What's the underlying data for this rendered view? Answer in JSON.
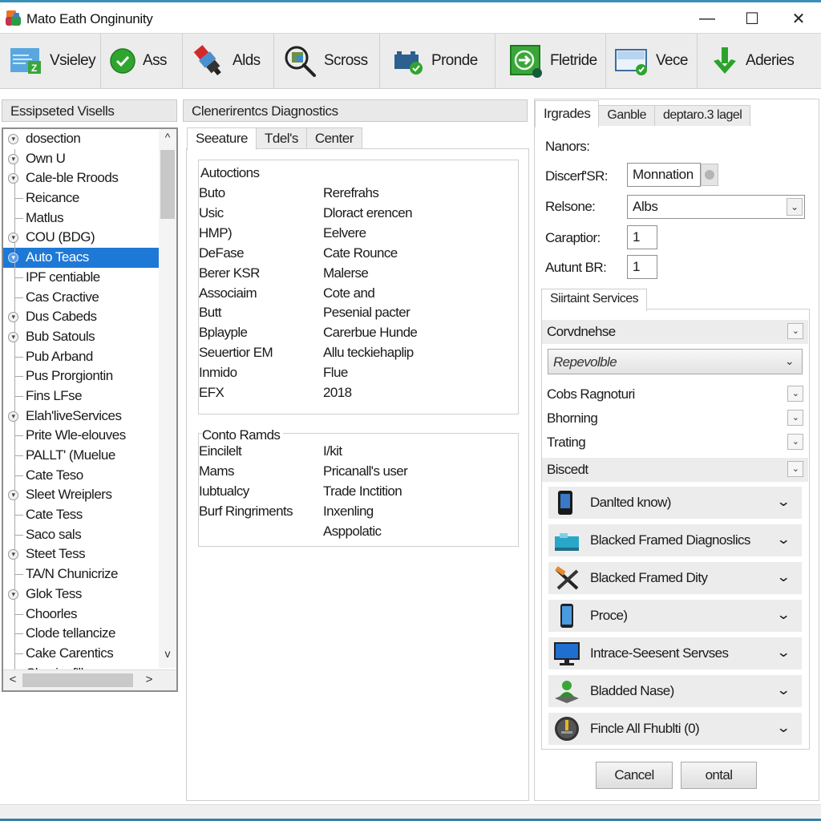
{
  "window": {
    "title": "Mato Eath Onginunity",
    "controls": {
      "minimize": "—",
      "maximize": "☐",
      "close": "✕"
    }
  },
  "toolbar": {
    "buttons": [
      {
        "label": "Vsieley",
        "icon": "spreadsheet-icon"
      },
      {
        "label": "Ass",
        "icon": "green-check-circle-icon"
      },
      {
        "label": "Alds",
        "icon": "connector-plug-icon"
      },
      {
        "label": "Scross",
        "icon": "magnifier-icon"
      },
      {
        "label": "Pronde",
        "icon": "battery-check-icon"
      },
      {
        "label": "Fletride",
        "icon": "green-arrow-box-icon"
      },
      {
        "label": "Vece",
        "icon": "monitor-check-icon"
      },
      {
        "label": "Aderies",
        "icon": "green-down-arrow-icon"
      }
    ]
  },
  "left_panel": {
    "header": "Essipseted Visells",
    "tree": [
      {
        "label": "dosection",
        "expandable": true,
        "root": true
      },
      {
        "label": "Own U",
        "expandable": true
      },
      {
        "label": "Cale-ble Rroods",
        "expandable": true
      },
      {
        "label": "Reicance",
        "expandable": false
      },
      {
        "label": "Matlus",
        "expandable": false
      },
      {
        "label": "COU (BDG)",
        "expandable": true
      },
      {
        "label": "Auto Teacs",
        "expandable": true,
        "selected": true
      },
      {
        "label": "IPF centiable",
        "expandable": false
      },
      {
        "label": "Cas Cractive",
        "expandable": false
      },
      {
        "label": "Dus Cabeds",
        "expandable": true
      },
      {
        "label": "Bub Satouls",
        "expandable": true
      },
      {
        "label": "Pub Arband",
        "expandable": false
      },
      {
        "label": "Pus Prorgiontin",
        "expandable": false
      },
      {
        "label": "Fins LFse",
        "expandable": false
      },
      {
        "label": "Elah'liveServices",
        "expandable": true
      },
      {
        "label": "Prite Wle-elouves",
        "expandable": false
      },
      {
        "label": "PALLT' (Muelue",
        "expandable": false
      },
      {
        "label": "Cate Teso",
        "expandable": false
      },
      {
        "label": "Sleet Wreiplers",
        "expandable": true
      },
      {
        "label": "Cate Tess",
        "expandable": false
      },
      {
        "label": "Saco sals",
        "expandable": false
      },
      {
        "label": "Steet Tess",
        "expandable": true
      },
      {
        "label": "TA/N Chunicrize",
        "expandable": false
      },
      {
        "label": "Glok Tess",
        "expandable": true
      },
      {
        "label": "Choorles",
        "expandable": false
      },
      {
        "label": "Clode tellancize",
        "expandable": false
      },
      {
        "label": "Cake Carentics",
        "expandable": false
      },
      {
        "label": "Clasrionf'll",
        "expandable": false
      }
    ],
    "scroll": {
      "up": "^",
      "down": "v",
      "left": "<",
      "right": ">"
    }
  },
  "middle_panel": {
    "header": "Clenerirentcs Diagnostics",
    "tabs": [
      "Seeature",
      "Tdel's",
      "Center"
    ],
    "active_tab": 0,
    "group1": {
      "title": "Autoctions",
      "rows": [
        {
          "key": "Buto",
          "value": "Rerefrahs"
        },
        {
          "key": "Usic",
          "value": "Dloract erencen"
        },
        {
          "key": "HMP)",
          "value": "Eelvere"
        },
        {
          "key": "DeFase",
          "value": "Cate Rounce"
        },
        {
          "key": "Berer KSR",
          "value": "Malerse"
        },
        {
          "key": "Associaim",
          "value": "Cote and"
        },
        {
          "key": "Butt",
          "value": "Pesenial pacter"
        },
        {
          "key": "Bplayple",
          "value": "Carerbue Hunde"
        },
        {
          "key": "Seuertior EM",
          "value": "Allu teckiehaplip"
        },
        {
          "key": "Inmido",
          "value": "Flue"
        },
        {
          "key": "EFX",
          "value": "2018"
        }
      ]
    },
    "group2": {
      "title": "Conto Ramds",
      "rows": [
        {
          "key": "Eincilelt",
          "value": "I/kit"
        },
        {
          "key": "Mams",
          "value": "Pricanall's user"
        },
        {
          "key": "Iubtualcy",
          "value": "Trade Inctition"
        },
        {
          "key": "Burf Ringriments",
          "value": "Inxenling"
        },
        {
          "key": "",
          "value": "Asppolatic"
        }
      ]
    }
  },
  "right_panel": {
    "tabs": [
      "Irgrades",
      "Ganble",
      "deptaro.3 lagel"
    ],
    "active_tab": 0,
    "form": {
      "section_label": "Nanors:",
      "fields": [
        {
          "label": "Discerf'SR:",
          "value": "Monnation"
        },
        {
          "label": "Relsone:",
          "value": "Albs"
        },
        {
          "label": "Caraptior:",
          "value": "1"
        },
        {
          "label": "Autunt BR:",
          "value": "1"
        }
      ]
    },
    "services": {
      "tab": "Siirtaint Services",
      "rows": [
        {
          "label": "Corvdnehse",
          "shaded": true
        },
        {
          "label": "Cobs Ragnoturi",
          "shaded": false
        },
        {
          "label": "Bhorning",
          "shaded": false
        },
        {
          "label": "Trating",
          "shaded": false
        },
        {
          "label": "Biscedt",
          "shaded": true
        }
      ],
      "select_value": "Repevolble",
      "categories": [
        {
          "label": "Danlted know)",
          "icon": "phone-device-icon"
        },
        {
          "label": "Blacked Framed Diagnoslics",
          "icon": "toolbox-icon"
        },
        {
          "label": "Blacked Framed Dity",
          "icon": "crossed-tools-icon"
        },
        {
          "label": "Proce)",
          "icon": "smartphone-icon"
        },
        {
          "label": "Intrace-Seesent Servses",
          "icon": "monitor-icon"
        },
        {
          "label": "Bladded Nase)",
          "icon": "network-user-icon"
        },
        {
          "label": "Fincle All Fhublti (0)",
          "icon": "warning-disc-icon"
        }
      ]
    },
    "buttons": {
      "cancel": "Cancel",
      "ok": "ontal"
    }
  }
}
